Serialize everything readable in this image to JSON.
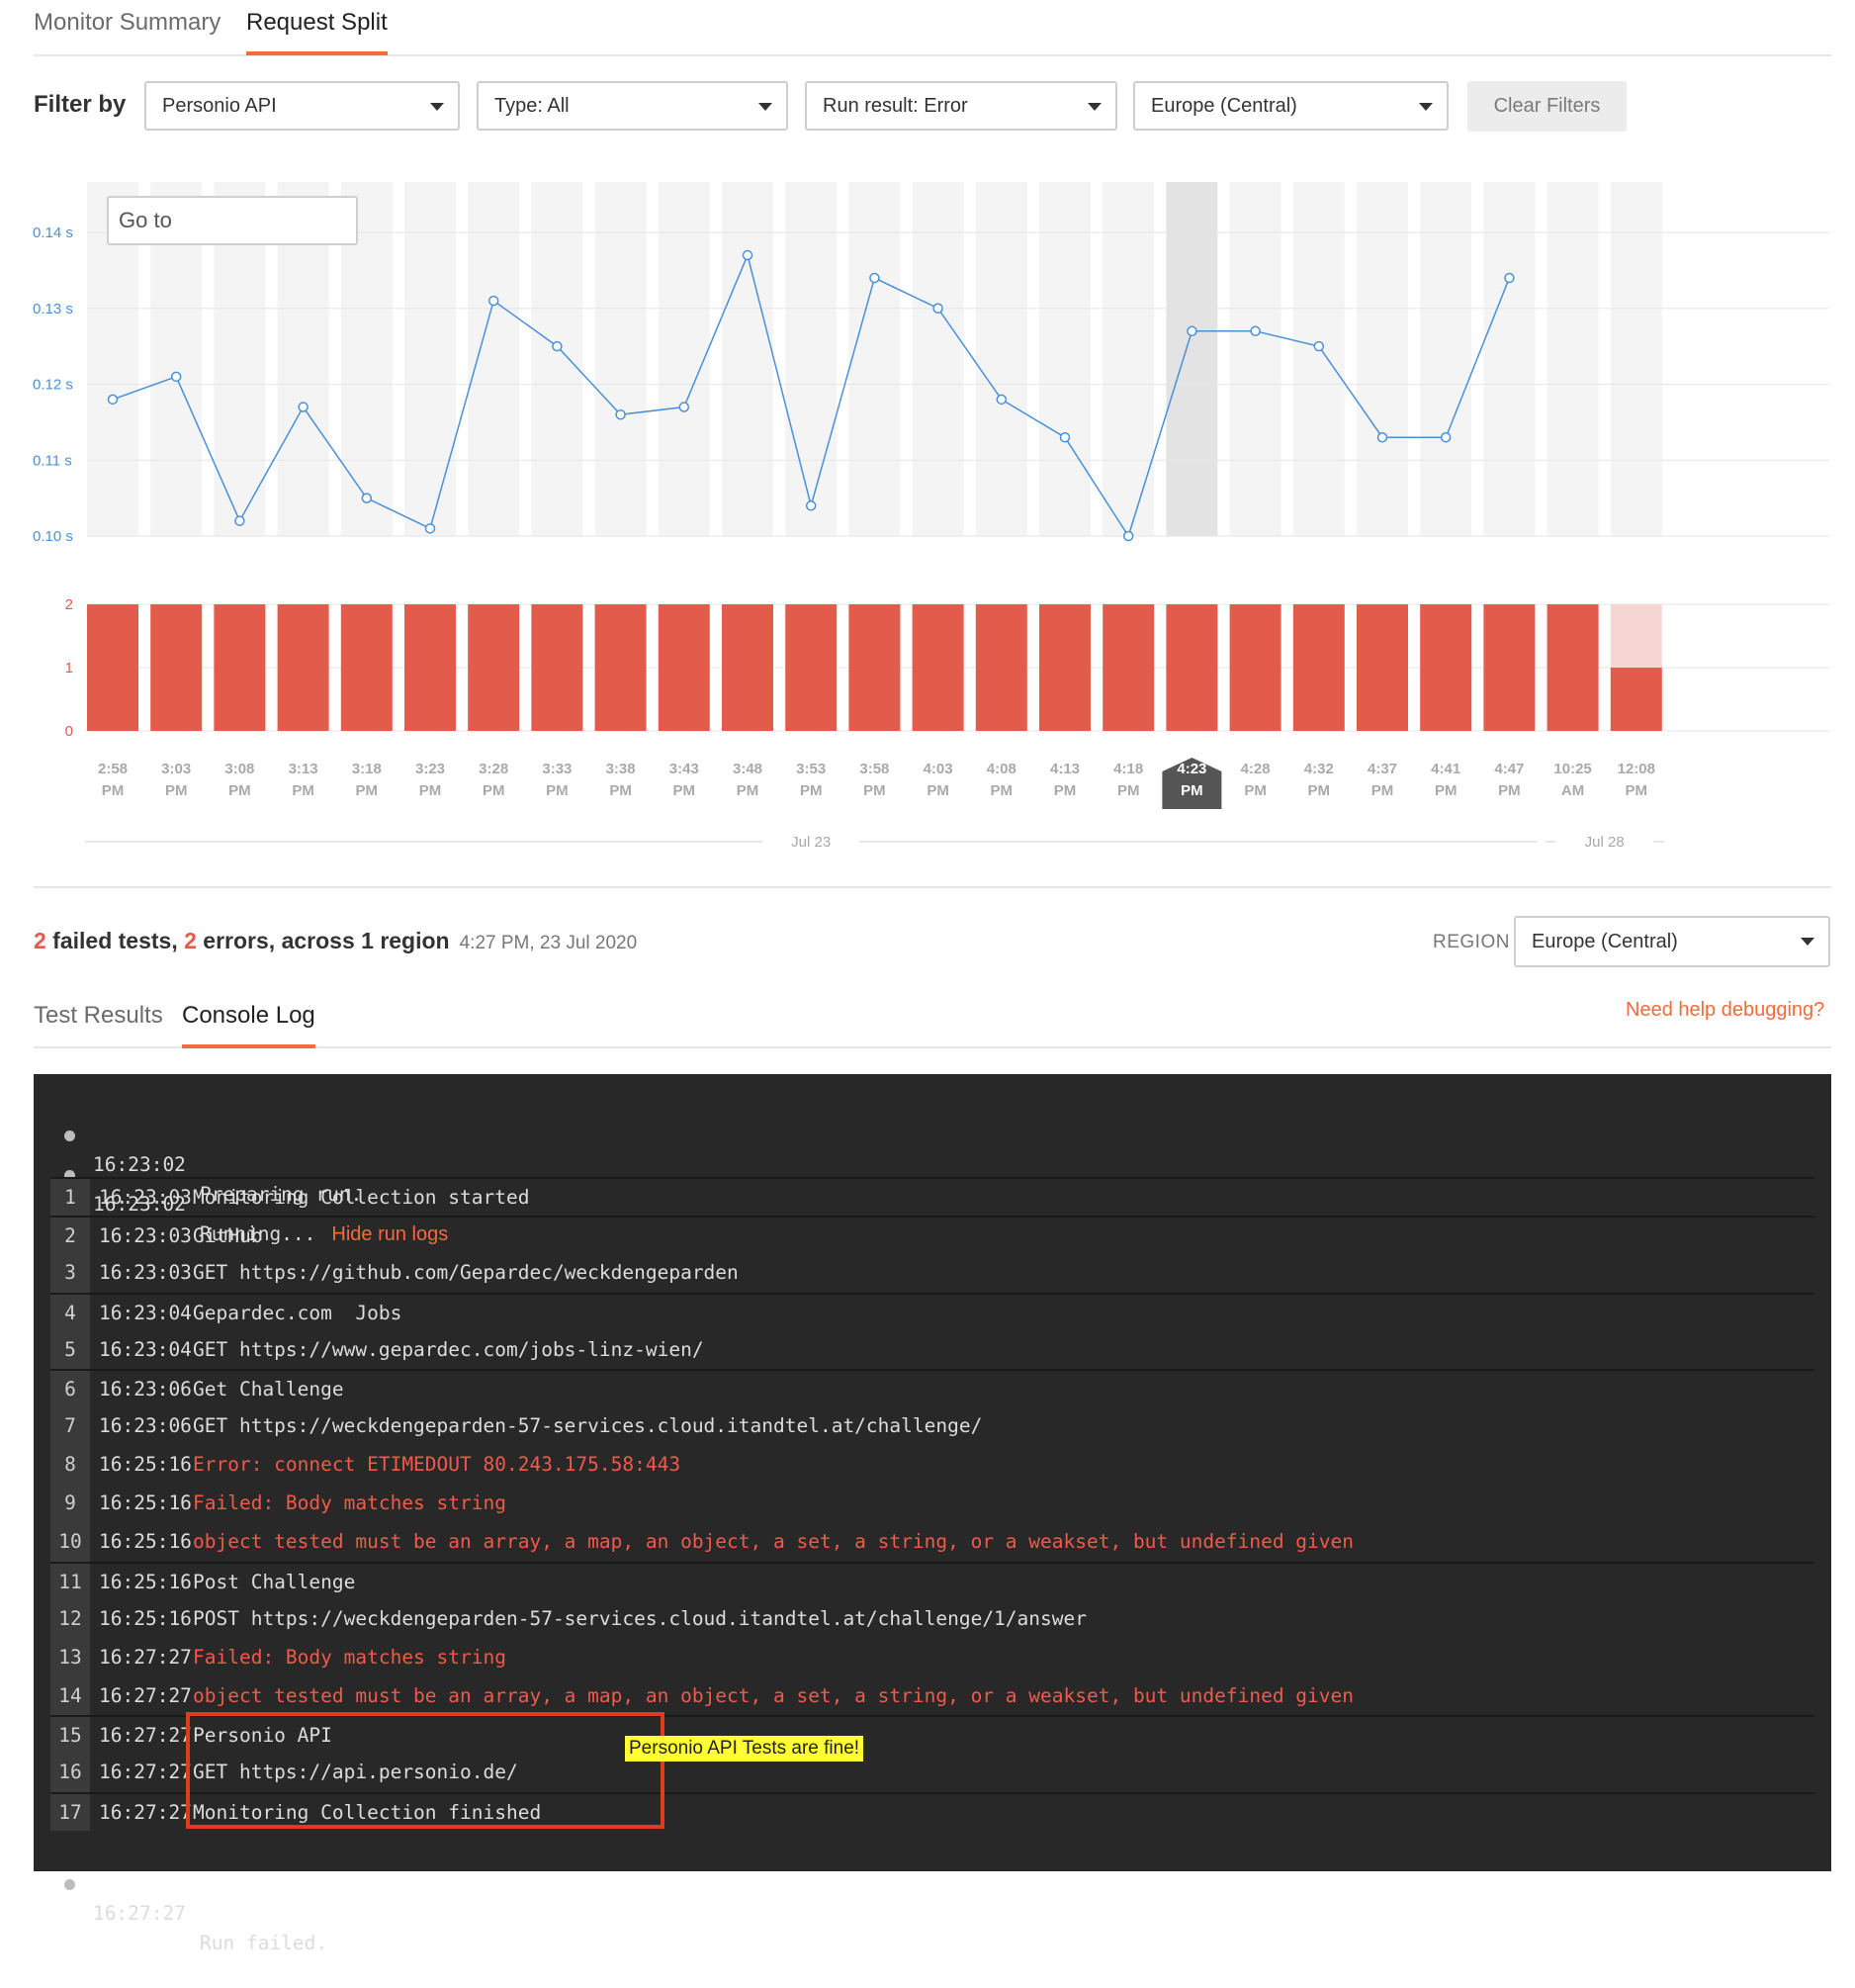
{
  "tabs": [
    {
      "label": "Monitor Summary",
      "active": false
    },
    {
      "label": "Request Split",
      "active": true
    }
  ],
  "filters": {
    "label": "Filter by",
    "monitor": "Personio API",
    "type": "Type: All",
    "run_result": "Run result: Error",
    "region": "Europe (Central)",
    "clear_label": "Clear Filters"
  },
  "goto_placeholder": "Go to",
  "chart_data": {
    "type": "line",
    "categories": [
      [
        "2:58",
        "PM"
      ],
      [
        "3:03",
        "PM"
      ],
      [
        "3:08",
        "PM"
      ],
      [
        "3:13",
        "PM"
      ],
      [
        "3:18",
        "PM"
      ],
      [
        "3:23",
        "PM"
      ],
      [
        "3:28",
        "PM"
      ],
      [
        "3:33",
        "PM"
      ],
      [
        "3:38",
        "PM"
      ],
      [
        "3:43",
        "PM"
      ],
      [
        "3:48",
        "PM"
      ],
      [
        "3:53",
        "PM"
      ],
      [
        "3:58",
        "PM"
      ],
      [
        "4:03",
        "PM"
      ],
      [
        "4:08",
        "PM"
      ],
      [
        "4:13",
        "PM"
      ],
      [
        "4:18",
        "PM"
      ],
      [
        "4:23",
        "PM"
      ],
      [
        "4:28",
        "PM"
      ],
      [
        "4:32",
        "PM"
      ],
      [
        "4:37",
        "PM"
      ],
      [
        "4:41",
        "PM"
      ],
      [
        "4:47",
        "PM"
      ],
      [
        "10:25",
        "AM"
      ],
      [
        "12:08",
        "PM"
      ]
    ],
    "response_time": {
      "ylim": [
        0.1,
        0.14
      ],
      "ticks": [
        "0.10 s",
        "0.11 s",
        "0.12 s",
        "0.13 s",
        "0.14 s"
      ],
      "tick_values": [
        0.1,
        0.11,
        0.12,
        0.13,
        0.14
      ],
      "values": [
        0.118,
        0.121,
        0.102,
        0.117,
        0.105,
        0.101,
        0.131,
        0.125,
        0.116,
        0.117,
        0.137,
        0.104,
        0.134,
        0.13,
        0.118,
        0.113,
        0.1,
        0.127,
        0.127,
        0.125,
        0.113,
        0.113,
        0.134,
        null,
        null
      ],
      "color": "#4a90d9"
    },
    "failures": {
      "type": "bar",
      "ylim": [
        0,
        2
      ],
      "ticks": [
        "0",
        "1",
        "2"
      ],
      "tick_values": [
        0,
        1,
        2
      ],
      "values": [
        2,
        2,
        2,
        2,
        2,
        2,
        2,
        2,
        2,
        2,
        2,
        2,
        2,
        2,
        2,
        2,
        2,
        2,
        2,
        2,
        2,
        2,
        2,
        2,
        1
      ],
      "color": "#e25b4b",
      "faded_color": "#f6d6d3"
    },
    "selected_index": 17,
    "date_groups": [
      {
        "label": "Jul 23",
        "start": 0,
        "end": 22
      },
      {
        "label": "Jul 28",
        "start": 23,
        "end": 24
      }
    ]
  },
  "summary": {
    "failed_count": "2",
    "failed_text": " failed tests, ",
    "error_count": "2",
    "error_text": " errors, across 1 region",
    "date": "4:27 PM, 23 Jul 2020"
  },
  "region": {
    "label": "REGION",
    "value": "Europe (Central)"
  },
  "result_tabs": [
    {
      "label": "Test Results",
      "active": false
    },
    {
      "label": "Console Log",
      "active": true
    }
  ],
  "help_link": "Need help debugging?",
  "console": {
    "pre": [
      {
        "time": "16:23:02",
        "msg": "Preparing run."
      },
      {
        "time": "16:23:02",
        "msg": "Running...",
        "link": "Hide run logs"
      }
    ],
    "rows": [
      {
        "n": "1",
        "time": "16:23:03",
        "msg": "Monitoring Collection started",
        "error": false,
        "group_start": true
      },
      {
        "n": "2",
        "time": "16:23:03",
        "msg": "GitHub",
        "error": false,
        "group_start": true
      },
      {
        "n": "3",
        "time": "16:23:03",
        "msg": "GET https://github.com/Gepardec/weckdengeparden",
        "error": false,
        "group_start": false
      },
      {
        "n": "4",
        "time": "16:23:04",
        "msg": "Gepardec.com  Jobs",
        "error": false,
        "group_start": true
      },
      {
        "n": "5",
        "time": "16:23:04",
        "msg": "GET https://www.gepardec.com/jobs-linz-wien/",
        "error": false,
        "group_start": false
      },
      {
        "n": "6",
        "time": "16:23:06",
        "msg": "Get Challenge",
        "error": false,
        "group_start": true
      },
      {
        "n": "7",
        "time": "16:23:06",
        "msg": "GET https://weckdengeparden-57-services.cloud.itandtel.at/challenge/",
        "error": false,
        "group_start": false
      },
      {
        "n": "8",
        "time": "16:25:16",
        "msg": "Error: connect ETIMEDOUT 80.243.175.58:443",
        "error": true,
        "group_start": false
      },
      {
        "n": "9",
        "time": "16:25:16",
        "msg": "Failed: Body matches string",
        "error": true,
        "group_start": false
      },
      {
        "n": "10",
        "time": "16:25:16",
        "msg": "object tested must be an array, a map, an object, a set, a string, or a weakset, but undefined given",
        "error": true,
        "group_start": false
      },
      {
        "n": "11",
        "time": "16:25:16",
        "msg": "Post Challenge",
        "error": false,
        "group_start": true
      },
      {
        "n": "12",
        "time": "16:25:16",
        "msg": "POST https://weckdengeparden-57-services.cloud.itandtel.at/challenge/1/answer",
        "error": false,
        "group_start": false
      },
      {
        "n": "13",
        "time": "16:27:27",
        "msg": "Failed: Body matches string",
        "error": true,
        "group_start": false
      },
      {
        "n": "14",
        "time": "16:27:27",
        "msg": "object tested must be an array, a map, an object, a set, a string, or a weakset, but undefined given",
        "error": true,
        "group_start": false
      },
      {
        "n": "15",
        "time": "16:27:27",
        "msg": "Personio API",
        "error": false,
        "group_start": true
      },
      {
        "n": "16",
        "time": "16:27:27",
        "msg": "GET https://api.personio.de/",
        "error": false,
        "group_start": false
      },
      {
        "n": "17",
        "time": "16:27:27",
        "msg": "Monitoring Collection finished",
        "error": false,
        "group_start": true
      }
    ],
    "post": [
      {
        "time": "16:27:27",
        "msg": "Run failed."
      }
    ]
  },
  "annotation": {
    "note": "Personio API Tests are fine!"
  }
}
